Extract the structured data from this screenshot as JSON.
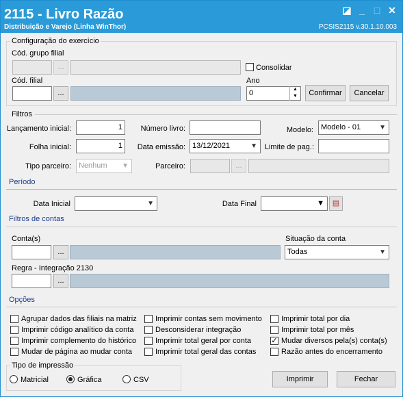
{
  "window": {
    "title": "2115 - Livro Razão",
    "subtitle": "Distribuição e Varejo (Linha WinThor)",
    "version": "PCSIS2115  v.30.1.10.003",
    "colors": {
      "titlebar": "#2a9ad8",
      "section": "#1a3c8c"
    }
  },
  "exercicio": {
    "legend": "Configuração do exercício",
    "grupo_label": "Cód. grupo filial",
    "consolidar_label": "Consolidar",
    "filial_label": "Cód. filial",
    "ano_label": "Ano",
    "ano_value": "0",
    "confirmar": "Confirmar",
    "cancelar": "Cancelar",
    "dots": "..."
  },
  "filtros": {
    "legend": "Filtros",
    "lanc_label": "Lançamento inicial:",
    "lanc_value": "1",
    "numlivro_label": "Número livro:",
    "modelo_label": "Modelo:",
    "modelo_value": "Modelo - 01",
    "folha_label": "Folha inicial:",
    "folha_value": "1",
    "data_emissao_label": "Data emissão:",
    "data_emissao_value": "13/12/2021",
    "limite_label": "Limite de pag.:",
    "tipo_parceiro_label": "Tipo parceiro:",
    "tipo_parceiro_value": "Nenhum",
    "parceiro_label": "Parceiro:"
  },
  "periodo": {
    "title": "Período",
    "data_inicial_label": "Data Inicial",
    "data_final_label": "Data Final"
  },
  "filtros_contas": {
    "title": "Filtros de contas",
    "contas_label": "Conta(s)",
    "situacao_label": "Situação da conta",
    "situacao_value": "Todas",
    "regra_label": "Regra - Integração 2130"
  },
  "opcoes": {
    "title": "Opções",
    "items": [
      {
        "label": "Agrupar dados das filiais na matriz",
        "checked": false
      },
      {
        "label": "Imprimir contas sem movimento",
        "checked": false
      },
      {
        "label": "Imprimir total por dia",
        "checked": false
      },
      {
        "label": "Imprimir código analítico da conta",
        "checked": false
      },
      {
        "label": "Desconsiderar integração",
        "checked": false
      },
      {
        "label": "Imprimir total por mês",
        "checked": false
      },
      {
        "label": "Imprimir complemento do histórico",
        "checked": false
      },
      {
        "label": "Imprimir total geral por conta",
        "checked": false
      },
      {
        "label": "Mudar diversos pela(s) conta(s)",
        "checked": true
      },
      {
        "label": "Mudar de página ao mudar conta",
        "checked": false
      },
      {
        "label": "Imprimir total geral das contas",
        "checked": false
      },
      {
        "label": "Razão antes do encerramento",
        "checked": false
      }
    ]
  },
  "impressao": {
    "legend": "Tipo de impressão",
    "matricial": "Matricial",
    "grafica": "Gráfica",
    "csv": "CSV",
    "selected": "Gráfica"
  },
  "actions": {
    "imprimir": "Imprimir",
    "fechar": "Fechar"
  }
}
